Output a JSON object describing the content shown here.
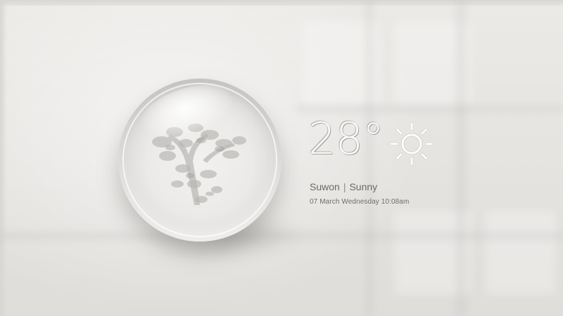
{
  "weather": {
    "temperature": "28°",
    "city": "Suwon",
    "separator": "|",
    "condition": "Sunny",
    "datetime": "07 March Wednesday 10:08am",
    "condition_icon": "sun-icon"
  },
  "colors": {
    "wall": "#e6e4e1",
    "text": "#6a6967",
    "orb_glass": "#ebeae8"
  }
}
